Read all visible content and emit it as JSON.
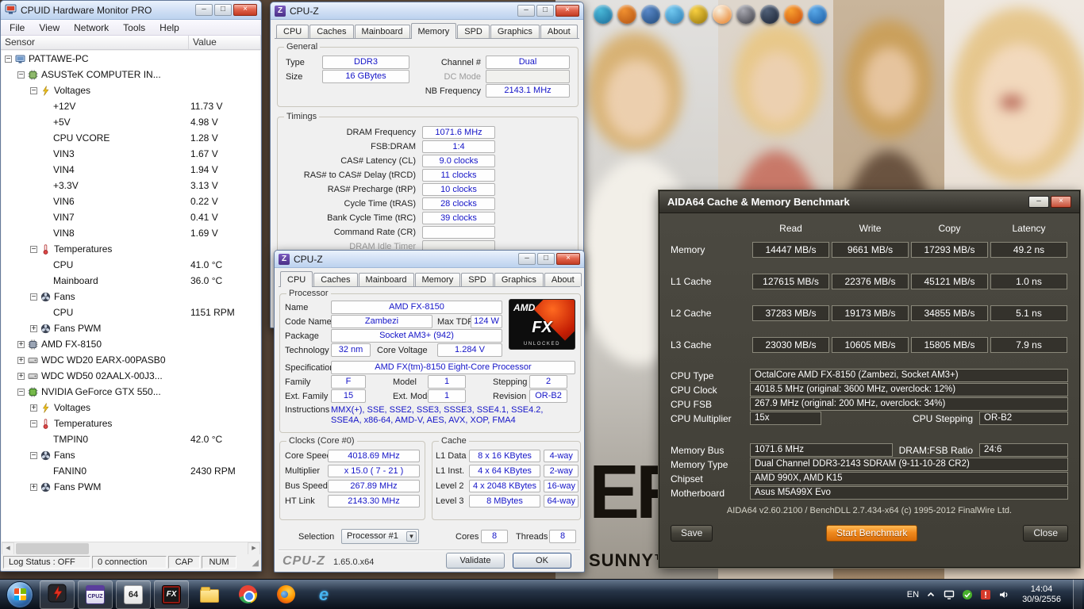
{
  "wallpaper": {
    "er_text": "ER",
    "sunny_text": "SUNNY™"
  },
  "dock_icons": [
    {
      "name": "dock-icon-1",
      "c1": "#49b8d8",
      "c2": "#1a6a98"
    },
    {
      "name": "dock-icon-2",
      "c1": "#f09030",
      "c2": "#b05010"
    },
    {
      "name": "dock-icon-3",
      "c1": "#5888c8",
      "c2": "#204878"
    },
    {
      "name": "dock-icon-4",
      "c1": "#70c8f0",
      "c2": "#2878b0"
    },
    {
      "name": "dock-icon-5",
      "c1": "#f8d040",
      "c2": "#907008"
    },
    {
      "name": "dock-icon-6",
      "c1": "#f8f0e0",
      "c2": "#e87818"
    },
    {
      "name": "dock-icon-7",
      "c1": "#a8a8b0",
      "c2": "#383840"
    },
    {
      "name": "dock-icon-8",
      "c1": "#506078",
      "c2": "#182030"
    },
    {
      "name": "dock-icon-9",
      "c1": "#f8a030",
      "c2": "#c84808"
    },
    {
      "name": "dock-icon-10",
      "c1": "#58a8e8",
      "c2": "#1858a0"
    }
  ],
  "hwmonitor": {
    "title": "CPUID Hardware Monitor PRO",
    "menu": [
      "File",
      "View",
      "Network",
      "Tools",
      "Help"
    ],
    "columns": [
      "Sensor",
      "Value"
    ],
    "tree": [
      {
        "lvl": 0,
        "exp": "minus",
        "icon": "computer",
        "label": "PATTAWE-PC",
        "value": ""
      },
      {
        "lvl": 1,
        "exp": "minus",
        "icon": "chip",
        "label": "ASUSTeK COMPUTER IN...",
        "value": ""
      },
      {
        "lvl": 2,
        "exp": "minus",
        "icon": "voltage",
        "label": "Voltages",
        "value": ""
      },
      {
        "lvl": 3,
        "label": "+12V",
        "value": "11.73 V"
      },
      {
        "lvl": 3,
        "label": "+5V",
        "value": "4.98 V"
      },
      {
        "lvl": 3,
        "label": "CPU VCORE",
        "value": "1.28 V"
      },
      {
        "lvl": 3,
        "label": "VIN3",
        "value": "1.67 V"
      },
      {
        "lvl": 3,
        "label": "VIN4",
        "value": "1.94 V"
      },
      {
        "lvl": 3,
        "label": "+3.3V",
        "value": "3.13 V"
      },
      {
        "lvl": 3,
        "label": "VIN6",
        "value": "0.22 V"
      },
      {
        "lvl": 3,
        "label": "VIN7",
        "value": "0.41 V"
      },
      {
        "lvl": 3,
        "label": "VIN8",
        "value": "1.69 V"
      },
      {
        "lvl": 2,
        "exp": "minus",
        "icon": "temperature",
        "label": "Temperatures",
        "value": ""
      },
      {
        "lvl": 3,
        "label": "CPU",
        "value": "41.0 °C"
      },
      {
        "lvl": 3,
        "label": "Mainboard",
        "value": "36.0 °C"
      },
      {
        "lvl": 2,
        "exp": "minus",
        "icon": "fan",
        "label": "Fans",
        "value": ""
      },
      {
        "lvl": 3,
        "label": "CPU",
        "value": "1151 RPM"
      },
      {
        "lvl": 2,
        "exp": "plus",
        "icon": "fan",
        "label": "Fans PWM",
        "value": ""
      },
      {
        "lvl": 1,
        "exp": "plus",
        "icon": "cpu",
        "label": "AMD FX-8150",
        "value": ""
      },
      {
        "lvl": 1,
        "exp": "plus",
        "icon": "disk",
        "label": "WDC WD20 EARX-00PASB0",
        "value": ""
      },
      {
        "lvl": 1,
        "exp": "plus",
        "icon": "disk",
        "label": "WDC WD50 02AALX-00J3...",
        "value": ""
      },
      {
        "lvl": 1,
        "exp": "minus",
        "icon": "gpu",
        "label": "NVIDIA GeForce GTX 550...",
        "value": ""
      },
      {
        "lvl": 2,
        "exp": "plus",
        "icon": "voltage",
        "label": "Voltages",
        "value": ""
      },
      {
        "lvl": 2,
        "exp": "minus",
        "icon": "temperature",
        "label": "Temperatures",
        "value": ""
      },
      {
        "lvl": 3,
        "label": "TMPIN0",
        "value": "42.0 °C"
      },
      {
        "lvl": 2,
        "exp": "minus",
        "icon": "fan",
        "label": "Fans",
        "value": ""
      },
      {
        "lvl": 3,
        "label": "FANIN0",
        "value": "2430 RPM"
      },
      {
        "lvl": 2,
        "exp": "plus",
        "icon": "fan",
        "label": "Fans PWM",
        "value": ""
      }
    ],
    "status": [
      "Log Status : OFF",
      "0 connection",
      "CAP",
      "NUM"
    ]
  },
  "cpuz_mem": {
    "title": "CPU-Z",
    "tabs": [
      "CPU",
      "Caches",
      "Mainboard",
      "Memory",
      "SPD",
      "Graphics",
      "About"
    ],
    "active_tab": "Memory",
    "general": {
      "group_label": "General",
      "type_label": "Type",
      "type": "DDR3",
      "channel_label": "Channel #",
      "channel": "Dual",
      "size_label": "Size",
      "size": "16 GBytes",
      "dc_mode_label": "DC Mode",
      "dc_mode": "",
      "nb_label": "NB Frequency",
      "nb": "2143.1 MHz"
    },
    "timings": {
      "group_label": "Timings",
      "rows": [
        {
          "label": "DRAM Frequency",
          "value": "1071.6 MHz"
        },
        {
          "label": "FSB:DRAM",
          "value": "1:4"
        },
        {
          "label": "CAS# Latency (CL)",
          "value": "9.0 clocks"
        },
        {
          "label": "RAS# to CAS# Delay (tRCD)",
          "value": "11 clocks"
        },
        {
          "label": "RAS# Precharge (tRP)",
          "value": "10 clocks"
        },
        {
          "label": "Cycle Time (tRAS)",
          "value": "28 clocks"
        },
        {
          "label": "Bank Cycle Time (tRC)",
          "value": "39 clocks"
        },
        {
          "label": "Command Rate (CR)",
          "value": ""
        },
        {
          "label": "DRAM Idle Timer",
          "value": "",
          "disabled": true
        }
      ]
    }
  },
  "cpuz_cpu": {
    "title": "CPU-Z",
    "tabs": [
      "CPU",
      "Caches",
      "Mainboard",
      "Memory",
      "SPD",
      "Graphics",
      "About"
    ],
    "active_tab": "CPU",
    "processor": {
      "group_label": "Processor",
      "name_label": "Name",
      "name": "AMD FX-8150",
      "code_name_label": "Code Name",
      "code_name": "Zambezi",
      "max_tdp_label": "Max TDP",
      "max_tdp": "124 W",
      "package_label": "Package",
      "package": "Socket AM3+ (942)",
      "technology_label": "Technology",
      "technology": "32 nm",
      "core_voltage_label": "Core Voltage",
      "core_voltage": "1.284 V",
      "specification_label": "Specification",
      "specification": "AMD FX(tm)-8150 Eight-Core Processor",
      "family_label": "Family",
      "family": "F",
      "model_label": "Model",
      "model": "1",
      "stepping_label": "Stepping",
      "stepping": "2",
      "ext_family_label": "Ext. Family",
      "ext_family": "15",
      "ext_model_label": "Ext. Model",
      "ext_model": "1",
      "revision_label": "Revision",
      "revision": "OR-B2",
      "instructions_label": "Instructions",
      "instructions": "MMX(+), SSE, SSE2, SSE3, SSSE3, SSE4.1, SSE4.2, SSE4A, x86-64, AMD-V, AES, AVX, XOP, FMA4",
      "logo": {
        "brand": "AMD",
        "fx": "FX",
        "unlocked": "UNLOCKED"
      }
    },
    "clocks": {
      "group_label": "Clocks (Core #0)",
      "rows": [
        {
          "label": "Core Speed",
          "value": "4018.69 MHz"
        },
        {
          "label": "Multiplier",
          "value": "x 15.0 ( 7 - 21 )"
        },
        {
          "label": "Bus Speed",
          "value": "267.89 MHz"
        },
        {
          "label": "HT Link",
          "value": "2143.30 MHz"
        }
      ]
    },
    "cache": {
      "group_label": "Cache",
      "rows": [
        {
          "label": "L1 Data",
          "size": "8 x 16 KBytes",
          "way": "4-way"
        },
        {
          "label": "L1 Inst.",
          "size": "4 x 64 KBytes",
          "way": "2-way"
        },
        {
          "label": "Level 2",
          "size": "4 x 2048 KBytes",
          "way": "16-way"
        },
        {
          "label": "Level 3",
          "size": "8 MBytes",
          "way": "64-way"
        }
      ]
    },
    "bottom": {
      "selection_label": "Selection",
      "selection": "Processor #1",
      "cores_label": "Cores",
      "cores": "8",
      "threads_label": "Threads",
      "threads": "8"
    },
    "footer": {
      "logo": "CPU-Z",
      "version": "1.65.0.x64",
      "validate": "Validate",
      "ok": "OK"
    }
  },
  "aida64": {
    "title": "AIDA64 Cache & Memory Benchmark",
    "bench": {
      "headers": [
        "Read",
        "Write",
        "Copy",
        "Latency"
      ],
      "rows": [
        {
          "label": "Memory",
          "read": "14447 MB/s",
          "write": "9661 MB/s",
          "copy": "17293 MB/s",
          "latency": "49.2 ns"
        },
        {
          "label": "L1 Cache",
          "read": "127615 MB/s",
          "write": "22376 MB/s",
          "copy": "45121 MB/s",
          "latency": "1.0 ns"
        },
        {
          "label": "L2 Cache",
          "read": "37283 MB/s",
          "write": "19173 MB/s",
          "copy": "34855 MB/s",
          "latency": "5.1 ns"
        },
        {
          "label": "L3 Cache",
          "read": "23030 MB/s",
          "write": "10605 MB/s",
          "copy": "15805 MB/s",
          "latency": "7.9 ns"
        }
      ]
    },
    "info": {
      "cpu_type_label": "CPU Type",
      "cpu_type": "OctalCore AMD FX-8150  (Zambezi, Socket AM3+)",
      "cpu_clock_label": "CPU Clock",
      "cpu_clock": "4018.5 MHz  (original: 3600 MHz, overclock: 12%)",
      "cpu_fsb_label": "CPU FSB",
      "cpu_fsb": "267.9 MHz  (original: 200 MHz, overclock: 34%)",
      "cpu_multiplier_label": "CPU Multiplier",
      "cpu_multiplier": "15x",
      "cpu_stepping_label": "CPU Stepping",
      "cpu_stepping": "OR-B2",
      "memory_bus_label": "Memory Bus",
      "memory_bus": "1071.6 MHz",
      "dram_fsb_label": "DRAM:FSB Ratio",
      "dram_fsb": "24:6",
      "memory_type_label": "Memory Type",
      "memory_type": "Dual Channel DDR3-2143 SDRAM  (9-11-10-28 CR2)",
      "chipset_label": "Chipset",
      "chipset": "AMD 990X, AMD K15",
      "motherboard_label": "Motherboard",
      "motherboard": "Asus M5A99X Evo"
    },
    "footer": "AIDA64 v2.60.2100 / BenchDLL 2.7.434-x64   (c) 1995-2012 FinalWire Ltd.",
    "buttons": {
      "save": "Save",
      "start": "Start Benchmark",
      "close": "Close"
    }
  },
  "taskbar": {
    "items": [
      {
        "name": "hwmonitor",
        "type": "bolt",
        "active": true
      },
      {
        "name": "cpuz",
        "type": "cpuz",
        "glyph": "CPUZ",
        "active": true
      },
      {
        "name": "aida64",
        "type": "aida",
        "glyph": "64",
        "active": true
      },
      {
        "name": "amd-fx",
        "type": "fx",
        "glyph": "FX",
        "active": true
      },
      {
        "name": "explorer",
        "type": "folder",
        "active": false
      },
      {
        "name": "chrome",
        "type": "chrome",
        "active": false
      },
      {
        "name": "firefox",
        "type": "firefox",
        "active": false
      },
      {
        "name": "internet-explorer",
        "type": "ie",
        "glyph": "e",
        "active": false
      }
    ],
    "tray": {
      "lang": "EN",
      "time": "14:04",
      "date": "30/9/2556"
    }
  }
}
